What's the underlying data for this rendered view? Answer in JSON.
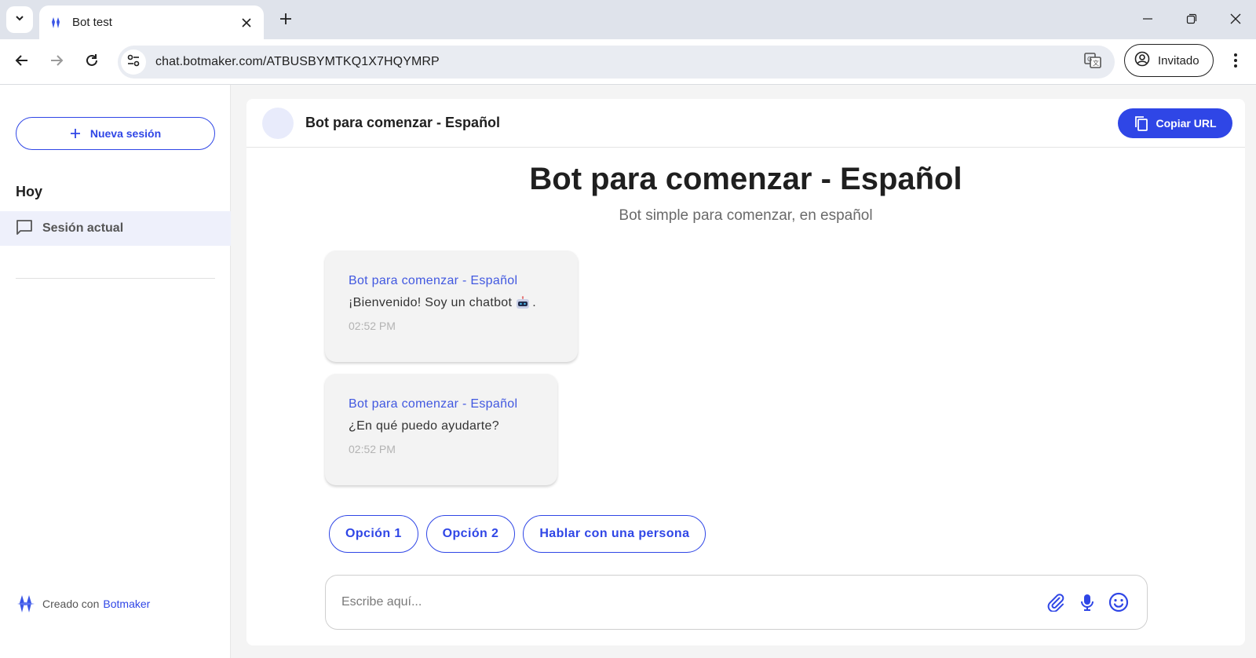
{
  "browser": {
    "tab_title": "Bot test",
    "url": "chat.botmaker.com/ATBUSBYMTKQ1X7HQYMRP",
    "profile_label": "Invitado"
  },
  "sidebar": {
    "new_session_label": "Nueva sesión",
    "section_today": "Hoy",
    "current_session_label": "Sesión actual",
    "footer_prefix": "Creado con",
    "footer_brand": "Botmaker"
  },
  "chat": {
    "header_title": "Bot para comenzar - Español",
    "copy_url_label": "Copiar URL",
    "title": "Bot para comenzar - Español",
    "subtitle": "Bot simple para comenzar, en español",
    "messages": [
      {
        "sender": "Bot para comenzar - Español",
        "text": "¡Bienvenido! Soy un chatbot",
        "emoji": "robot-emoji",
        "suffix": ".",
        "time": "02:52 PM"
      },
      {
        "sender": "Bot para comenzar - Español",
        "text": "¿En qué puedo ayudarte?",
        "time": "02:52 PM"
      }
    ],
    "options": [
      "Opción 1",
      "Opción 2",
      "Hablar con una persona"
    ],
    "input_placeholder": "Escribe aquí..."
  },
  "colors": {
    "accent": "#2f46e6",
    "tabbar": "#dfe3eb",
    "bubble": "#f3f3f3"
  }
}
